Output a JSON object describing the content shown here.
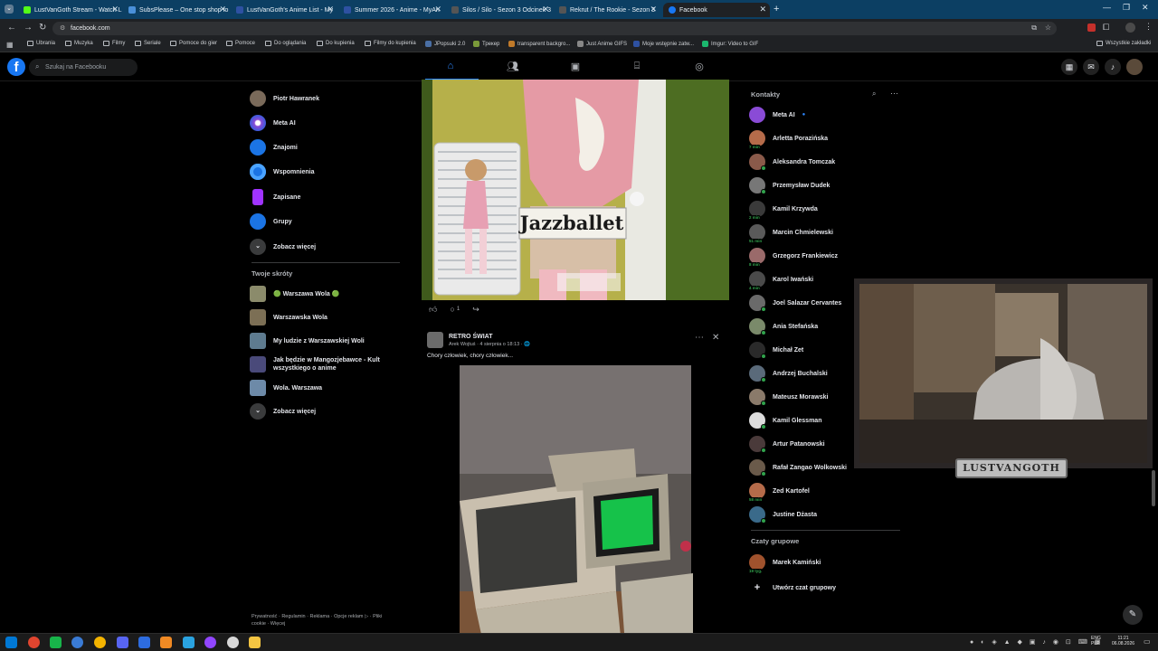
{
  "browser": {
    "tabs": [
      {
        "title": "LustVanGoth Stream - Watch L",
        "color": "#53fc18"
      },
      {
        "title": "SubsPlease – One stop shop fo",
        "color": "#4a90d9"
      },
      {
        "title": "LustVanGoth's Anime List - My",
        "color": "#2e51a2"
      },
      {
        "title": "Summer 2026 - Anime - MyAn",
        "color": "#2e51a2"
      },
      {
        "title": "Silos / Silo - Sezon 3 Odcinek 3",
        "color": "#d33"
      },
      {
        "title": "Rekrut / The Rookie - Sezon 3",
        "color": "#d33"
      },
      {
        "title": "Facebook",
        "color": "#1877f2"
      }
    ],
    "url": "facebook.com",
    "bookmarks": [
      "Ubrania",
      "Muzyka",
      "Filmy",
      "Seriale",
      "Pomoce do gier",
      "Pomoce",
      "Do oglądania",
      "Do kupienia",
      "Filmy do kupienia",
      "JPopsuki 2.0",
      "Трекер",
      "transparent backgro...",
      "Just Anime GIFS",
      "Moje wstępnie zatw...",
      "Imgur: Video to GIF"
    ],
    "all_bookmarks": "Wszystkie zakładki"
  },
  "facebook": {
    "logo": "f",
    "search_placeholder": "Szukaj na Facebooku",
    "left": {
      "items": [
        {
          "label": "Piotr Hawranek",
          "color": "#7a6a5a"
        },
        {
          "label": "Meta AI",
          "color": "#8a4bd6"
        },
        {
          "label": "Znajomi",
          "color": "#1b74e4"
        },
        {
          "label": "Wspomnienia",
          "color": "#1b74e4"
        },
        {
          "label": "Zapisane",
          "color": "#a033ff"
        },
        {
          "label": "Grupy",
          "color": "#1b74e4"
        },
        {
          "label": "Zobacz więcej",
          "color": "#3a3b3c"
        }
      ],
      "shortcuts_title": "Twoje skróty",
      "shortcuts": [
        {
          "label": "🟢 Warszawa Wola 🟢",
          "color": "#8b8b6b"
        },
        {
          "label": "Warszawska Wola",
          "color": "#7c6f55"
        },
        {
          "label": "My ludzie z Warszawskiej Woli",
          "color": "#5e7b8f"
        },
        {
          "label": "Jak będzie w Mangozjebawce - Kult",
          "label2": "wszystkiego o anime",
          "color": "#4a4a7a"
        },
        {
          "label": "Wola. Warszawa",
          "color": "#6d8aa8"
        },
        {
          "label": "Zobacz więcej",
          "color": "#3a3b3c"
        }
      ],
      "footer": "Prywatność · Regulamin · Reklama · Opcje reklam ▷ · Pliki cookie · Więcej"
    },
    "post1": {
      "image_caption": "Jazzballet",
      "comments": "1"
    },
    "post2": {
      "page_name": "RETRO ŚWIAT",
      "meta": "Arek Wojtuś · 4 sierpnia o 18:13 · 🌐",
      "text": "Chory człowiek, chory człowiek..."
    },
    "right": {
      "contacts_title": "Kontakty",
      "contacts": [
        {
          "name": "Meta AI",
          "color": "#8a4bd6",
          "online": false,
          "mins": ""
        },
        {
          "name": "Arletta Porazińska",
          "color": "#b56b4a",
          "online": false,
          "mins": "7 min"
        },
        {
          "name": "Aleksandra Tomczak",
          "color": "#8a5a4a",
          "online": true,
          "mins": ""
        },
        {
          "name": "Przemysław Dudek",
          "color": "#777",
          "online": true,
          "mins": ""
        },
        {
          "name": "Kamil Krzywda",
          "color": "#3a3a3a",
          "online": false,
          "mins": "2 min"
        },
        {
          "name": "Marcin Chmielewski",
          "color": "#5a5a5a",
          "online": false,
          "mins": "51 min"
        },
        {
          "name": "Grzegorz Frankiewicz",
          "color": "#9a6a6a",
          "online": false,
          "mins": "8 min"
        },
        {
          "name": "Karol Iwański",
          "color": "#4a4a4a",
          "online": false,
          "mins": "4 min"
        },
        {
          "name": "Joel Salazar Cervantes",
          "color": "#6a6a6a",
          "online": true,
          "mins": ""
        },
        {
          "name": "Ania Stefańska",
          "color": "#7a8a6a",
          "online": true,
          "mins": ""
        },
        {
          "name": "Michał Zet",
          "color": "#2a2a2a",
          "online": true,
          "mins": ""
        },
        {
          "name": "Andrzej Buchalski",
          "color": "#5a6a7a",
          "online": true,
          "mins": ""
        },
        {
          "name": "Mateusz Morawski",
          "color": "#8a7a6a",
          "online": true,
          "mins": ""
        },
        {
          "name": "Kamil Glessman",
          "color": "#dcdcdc",
          "online": true,
          "mins": ""
        },
        {
          "name": "Artur Patanowski",
          "color": "#4a3a3a",
          "online": true,
          "mins": ""
        },
        {
          "name": "Rafał Zangao Wolkowski",
          "color": "#6a5a4a",
          "online": true,
          "mins": ""
        },
        {
          "name": "Zed Kartofel",
          "color": "#b56b4a",
          "online": false,
          "mins": "58 min"
        },
        {
          "name": "Justine Dżasta",
          "color": "#3a6a8a",
          "online": true,
          "mins": ""
        }
      ],
      "group_chats_title": "Czaty grupowe",
      "group_chats": [
        {
          "name": "Marek Kamiński",
          "color": "#a0522d",
          "mins": "19 tyg."
        }
      ],
      "create_group": "Utwórz czat grupowy"
    }
  },
  "overlay": {
    "text": "LUSTVANGOTH"
  },
  "taskbar": {
    "lang1": "ENG",
    "lang2": "PLP",
    "time": "11:21",
    "date": "06.08.2026"
  }
}
